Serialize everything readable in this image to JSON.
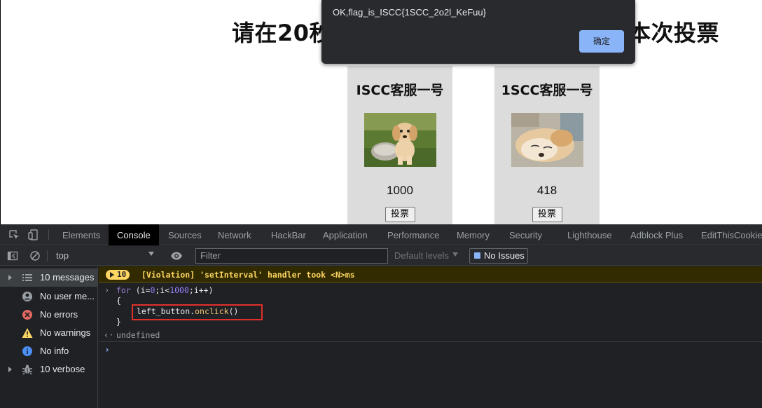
{
  "page": {
    "title_left": "请在20秒",
    "title_right": "本次投票",
    "candidates": [
      {
        "name": "ISCC客服一号",
        "votes": "1000",
        "vote_label": "投票",
        "photo": "golden-puppy-photo"
      },
      {
        "name": "1SCC客服一号",
        "votes": "418",
        "vote_label": "投票",
        "photo": "sleeping-dog-photo"
      }
    ]
  },
  "alert": {
    "message": "OK,flag_is_ISCC{1SCC_2o2l_KeFuu}",
    "ok_label": "确定"
  },
  "devtools": {
    "tabs": [
      "Elements",
      "Console",
      "Sources",
      "Network",
      "HackBar",
      "Application",
      "Performance",
      "Memory",
      "Security",
      "Lighthouse",
      "Adblock Plus",
      "EditThisCookie"
    ],
    "active_tab": "Console",
    "toolbar": {
      "context": "top",
      "filter_placeholder": "Filter",
      "levels": "Default levels",
      "issues": "No Issues"
    },
    "sidebar": [
      {
        "label": "10 messages",
        "icon": "list-icon",
        "expandable": true,
        "selected": true
      },
      {
        "label": "No user me...",
        "icon": "user-icon",
        "expandable": false
      },
      {
        "label": "No errors",
        "icon": "error-icon",
        "expandable": false
      },
      {
        "label": "No warnings",
        "icon": "warning-icon",
        "expandable": false
      },
      {
        "label": "No info",
        "icon": "info-icon",
        "expandable": false
      },
      {
        "label": "10 verbose",
        "icon": "bug-icon",
        "expandable": true
      }
    ],
    "console": {
      "violation_count": "10",
      "violation_text": "[Violation] 'setInterval' handler took <N>ms",
      "code": {
        "line1_kw": "for",
        "line1_a": " (i=",
        "line1_n0": "0",
        "line1_b": ";i<",
        "line1_n1": "1000",
        "line1_c": ";i++)",
        "line2": "{",
        "line3_obj": "left_button.",
        "line3_fn": "onclick",
        "line3_end": "()",
        "line4": "}"
      },
      "result": "undefined"
    }
  },
  "colors": {
    "devtools_bg": "#202124",
    "highlight_box": "#e0302b",
    "alert_button": "#8ab4f8",
    "violation_text": "#fdd663"
  }
}
